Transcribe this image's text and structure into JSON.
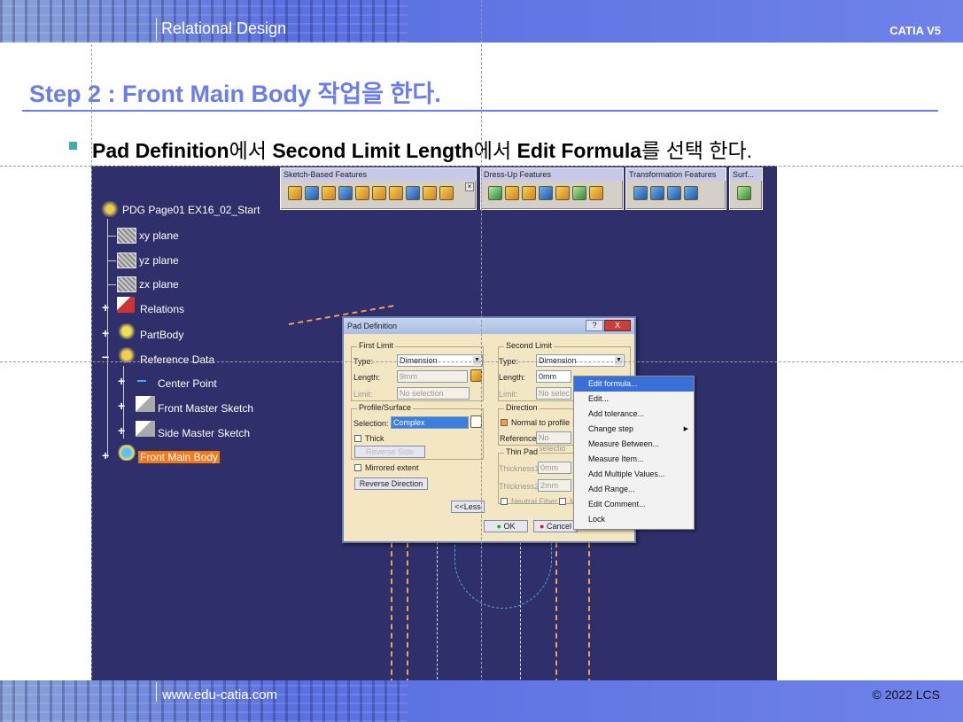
{
  "header": {
    "title": "Relational Design",
    "product": "CATIA V5"
  },
  "footer": {
    "website": "www.edu-catia.com",
    "copyright": "© 2022 LCS"
  },
  "step": {
    "title": "Step 2 : Front Main Body 작업을 한다.",
    "instruction": {
      "b1": "Pad Definition",
      "t1": "에서 ",
      "b2": "Second Limit Length",
      "t2": "에서 ",
      "b3": "Edit Formula",
      "t3": "를 선택 한다."
    }
  },
  "toolbars": [
    {
      "title": "Sketch-Based Features"
    },
    {
      "title": "Dress-Up Features"
    },
    {
      "title": "Transformation Features"
    },
    {
      "title": "Surf..."
    }
  ],
  "tree": {
    "root": "PDG Page01 EX16_02_Start",
    "items": [
      "xy plane",
      "yz plane",
      "zx plane",
      "Relations",
      "PartBody",
      "Reference Data",
      "Center Point",
      "Front Master Sketch",
      "Side Master Sketch",
      "Front Main Body"
    ]
  },
  "dialog": {
    "title": "Pad Definition",
    "help": "?",
    "close": "X",
    "first_limit": {
      "group": "First Limit",
      "type_label": "Type:",
      "type_value": "Dimension",
      "length_label": "Length:",
      "length_value": "9mm",
      "limit_label": "Limit:",
      "limit_value": "No selection"
    },
    "profile": {
      "group": "Profile/Surface",
      "selection_label": "Selection:",
      "selection_value": "Complex",
      "thick": "Thick",
      "reverse_side": "Reverse Side"
    },
    "mirrored": "Mirrored extent",
    "reverse_direction": "Reverse Direction",
    "less": "<<Less",
    "second_limit": {
      "group": "Second Limit",
      "type_label": "Type:",
      "type_value": "Dimension",
      "length_label": "Length:",
      "length_value": "0mm",
      "limit_label": "Limit:",
      "limit_value": "No selec"
    },
    "direction": {
      "group": "Direction",
      "normal": "Normal to profile",
      "reference_label": "Reference:",
      "reference_value": "No selectio"
    },
    "thin_pad": {
      "group": "Thin Pad",
      "t1_label": "Thickness1:",
      "t1_value": "0mm",
      "t2_label": "Thickness2:",
      "t2_value": "2mm",
      "neutral": "Neutral Fiber",
      "merge": "M"
    },
    "ok": "OK",
    "cancel": "Cancel"
  },
  "context_menu": [
    "Edit formula...",
    "Edit...",
    "Add tolerance...",
    "Change step",
    "Measure Between...",
    "Measure Item...",
    "Add Multiple Values...",
    "Add Range...",
    "Edit Comment...",
    "Lock"
  ],
  "colors": {
    "accent": "#6a7de8",
    "viewport": "#2f2f6b",
    "selection": "#f07a18"
  }
}
